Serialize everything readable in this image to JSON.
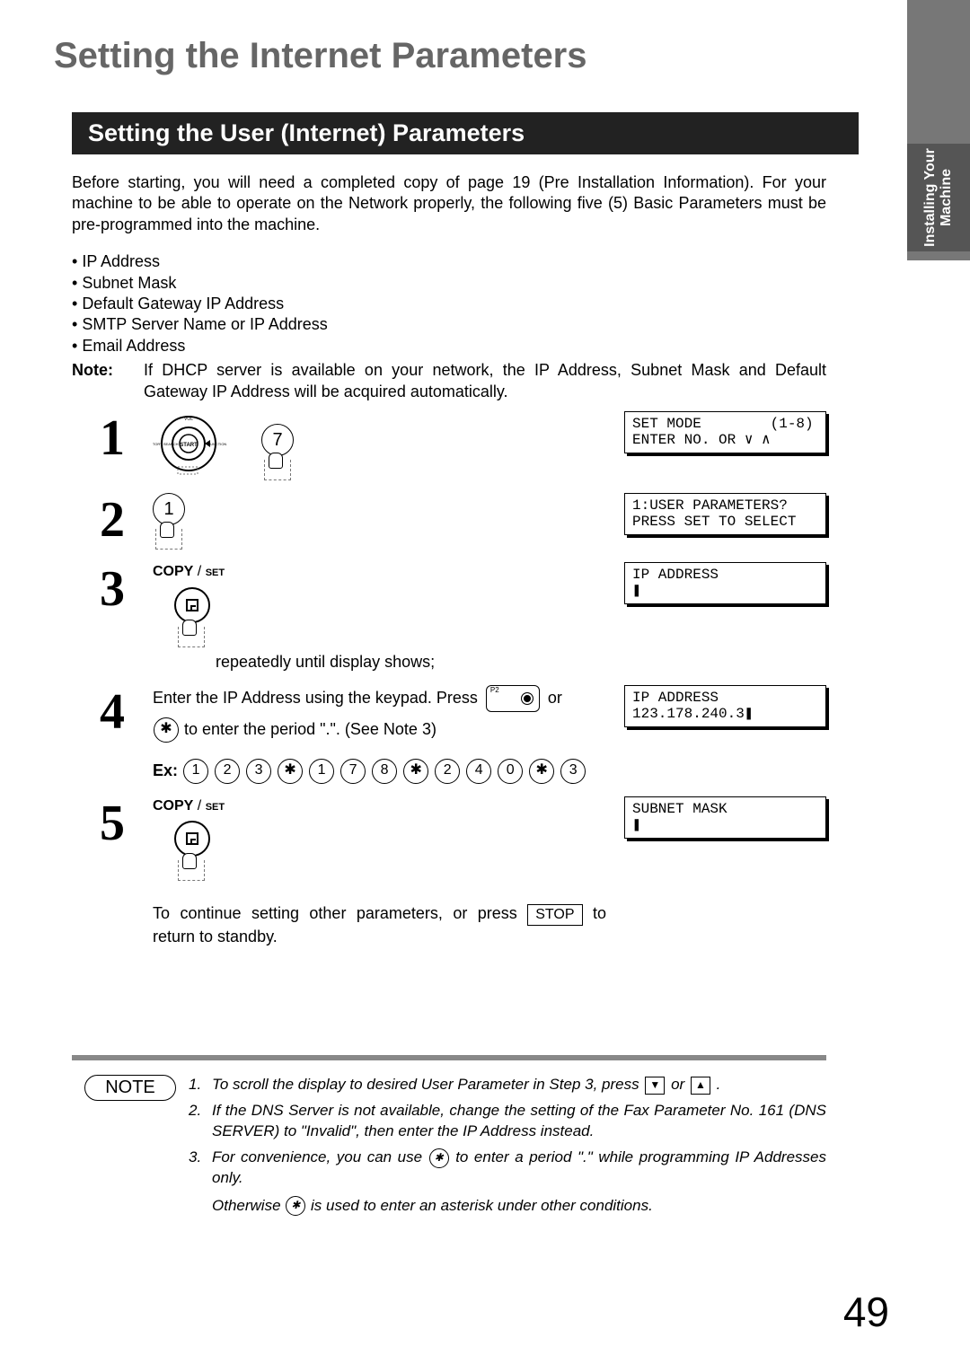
{
  "page_title": "Setting the Internet Parameters",
  "section_title": "Setting the User (Internet) Parameters",
  "side_tab": "Installing Your\nMachine",
  "intro": "Before starting, you will need a completed copy of page 19 (Pre Installation Information).  For your machine to be able to operate on the Network properly, the following five (5) Basic Parameters must be pre-programmed into the machine.",
  "param_list": [
    "IP Address",
    "Subnet Mask",
    "Default Gateway IP Address",
    "SMTP Server Name or IP Address",
    "Email Address"
  ],
  "note_label": "Note:",
  "note_text": "If DHCP server is available on your network, the IP Address, Subnet Mask and Default Gateway IP Address will be acquired automatically.",
  "steps": {
    "s1": {
      "num": "1",
      "key": "7",
      "lcd": "SET MODE        (1-8)\nENTER NO. OR ∨ ∧"
    },
    "s2": {
      "num": "2",
      "key": "1",
      "lcd": "1:USER PARAMETERS?\nPRESS SET TO SELECT"
    },
    "s3": {
      "num": "3",
      "copy_label": "COPY / SET",
      "tail_text": "repeatedly until display shows;",
      "lcd": "IP ADDRESS\n❚"
    },
    "s4": {
      "num": "4",
      "line1a": "Enter the IP Address using the keypad. Press ",
      "line1b": " or ",
      "line2": " to enter the period \".\".  (See Note 3)",
      "ex_label": "Ex:",
      "ex_keys": [
        "1",
        "2",
        "3",
        "✱",
        "1",
        "7",
        "8",
        "✱",
        "2",
        "4",
        "0",
        "✱",
        "3"
      ],
      "lcd": "IP ADDRESS\n123.178.240.3❚"
    },
    "s5": {
      "num": "5",
      "copy_label": "COPY / SET",
      "cont_a": "To continue setting other parameters, or press ",
      "stop_label": "STOP",
      "cont_b": " to return to standby.",
      "lcd": "SUBNET MASK\n❚"
    }
  },
  "footnotes": {
    "badge": "NOTE",
    "items": [
      {
        "idx": "1.",
        "text_a": "To scroll the display to desired User Parameter in Step 3, press ",
        "text_b": " or ",
        "text_c": "."
      },
      {
        "idx": "2.",
        "text": "If the DNS Server is not available, change the setting of the Fax Parameter No. 161 (DNS SERVER) to \"Invalid\", then enter the IP Address instead."
      },
      {
        "idx": "3.",
        "text_a": "For convenience, you can use ",
        "text_b": " to enter a period \".\" while programming IP Addresses only.",
        "text_c": "Otherwise ",
        "text_d": " is used to enter an asterisk under other conditions."
      }
    ]
  },
  "page_number": "49"
}
